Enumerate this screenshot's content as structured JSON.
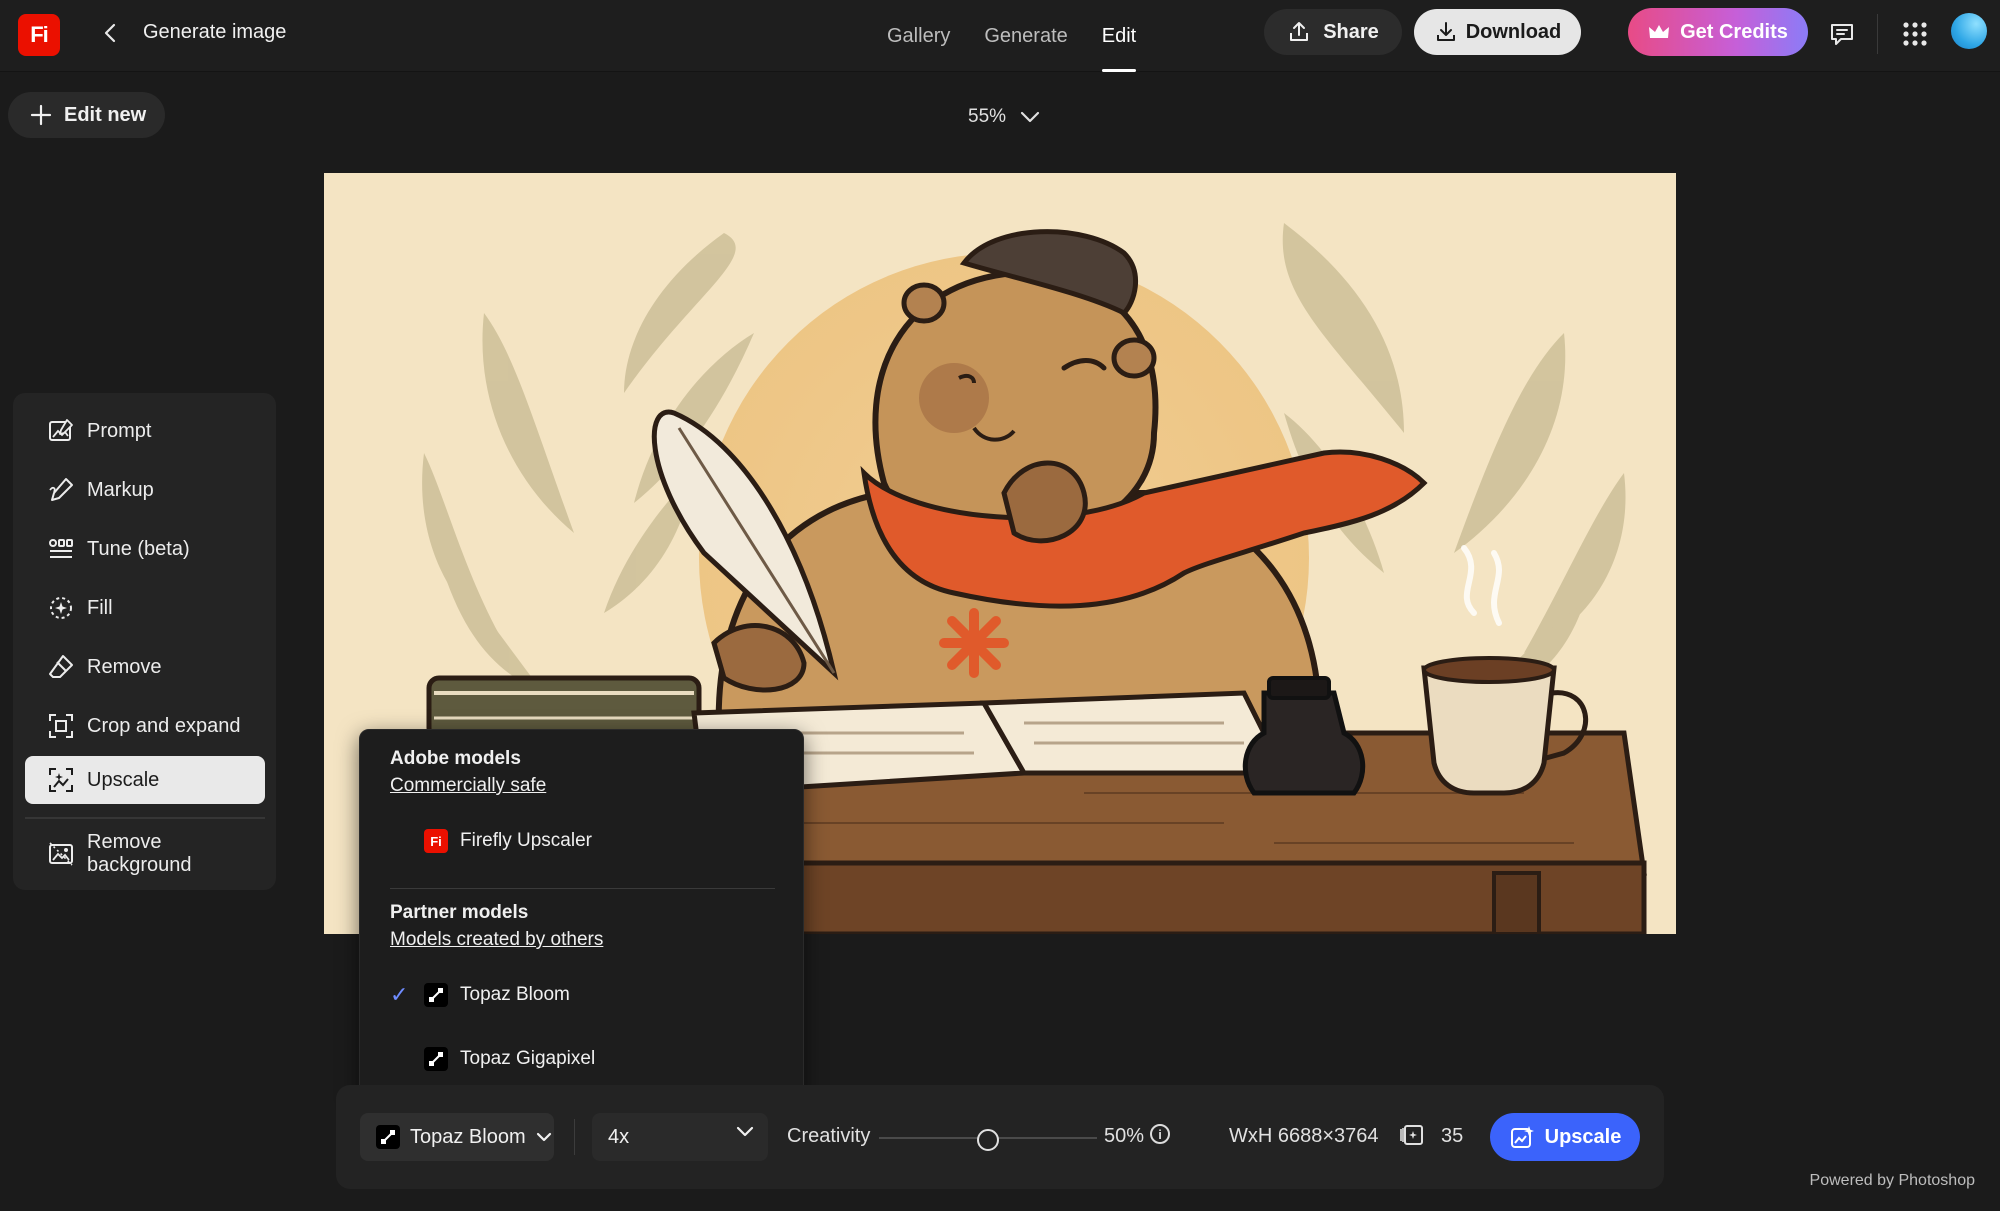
{
  "header": {
    "logo_text": "Fi",
    "title": "Generate image",
    "nav": [
      {
        "label": "Gallery",
        "active": false
      },
      {
        "label": "Generate",
        "active": false
      },
      {
        "label": "Edit",
        "active": true
      }
    ],
    "share_label": "Share",
    "download_label": "Download",
    "credits_label": "Get Credits",
    "icons": [
      "back-icon",
      "share-icon",
      "download-icon",
      "crown-icon",
      "feedback-icon",
      "apps-grid-icon",
      "avatar"
    ]
  },
  "edit_new_label": "Edit new",
  "zoom": {
    "value": "55%"
  },
  "tools": [
    {
      "label": "Prompt",
      "icon": "prompt-icon",
      "active": false
    },
    {
      "label": "Markup",
      "icon": "markup-icon",
      "active": false
    },
    {
      "label": "Tune (beta)",
      "icon": "tune-icon",
      "active": false
    },
    {
      "label": "Fill",
      "icon": "fill-icon",
      "active": false
    },
    {
      "label": "Remove",
      "icon": "remove-icon",
      "active": false
    },
    {
      "label": "Crop and expand",
      "icon": "crop-expand-icon",
      "active": false
    },
    {
      "label": "Upscale",
      "icon": "upscale-icon",
      "active": true
    },
    {
      "label": "Remove background",
      "icon": "remove-background-icon",
      "active": false
    }
  ],
  "model_menu": {
    "adobe_heading": "Adobe models",
    "adobe_link": "Commercially safe",
    "adobe_items": [
      {
        "label": "Firefly Upscaler",
        "icon_text": "Fi",
        "selected": false
      }
    ],
    "partner_heading": "Partner models",
    "partner_link": "Models created by others",
    "partner_items": [
      {
        "label": "Topaz Bloom",
        "selected": true
      },
      {
        "label": "Topaz Gigapixel",
        "selected": false
      }
    ]
  },
  "bottom": {
    "model_value": "Topaz Bloom",
    "scale_value": "4x",
    "creativity_label": "Creativity",
    "creativity_value": 0.5,
    "creativity_text": "50%",
    "dimensions": "WxH 6688×3764",
    "credit_cost": "35",
    "upscale_label": "Upscale"
  },
  "footer": {
    "powered_by": "Powered by Photoshop"
  },
  "colors": {
    "background": "#1b1b1b",
    "accent_blue": "#3b63fb",
    "brand_red": "#eb1000",
    "credits_gradient_start": "#e84b86",
    "credits_gradient_end": "#8b7cf7"
  }
}
